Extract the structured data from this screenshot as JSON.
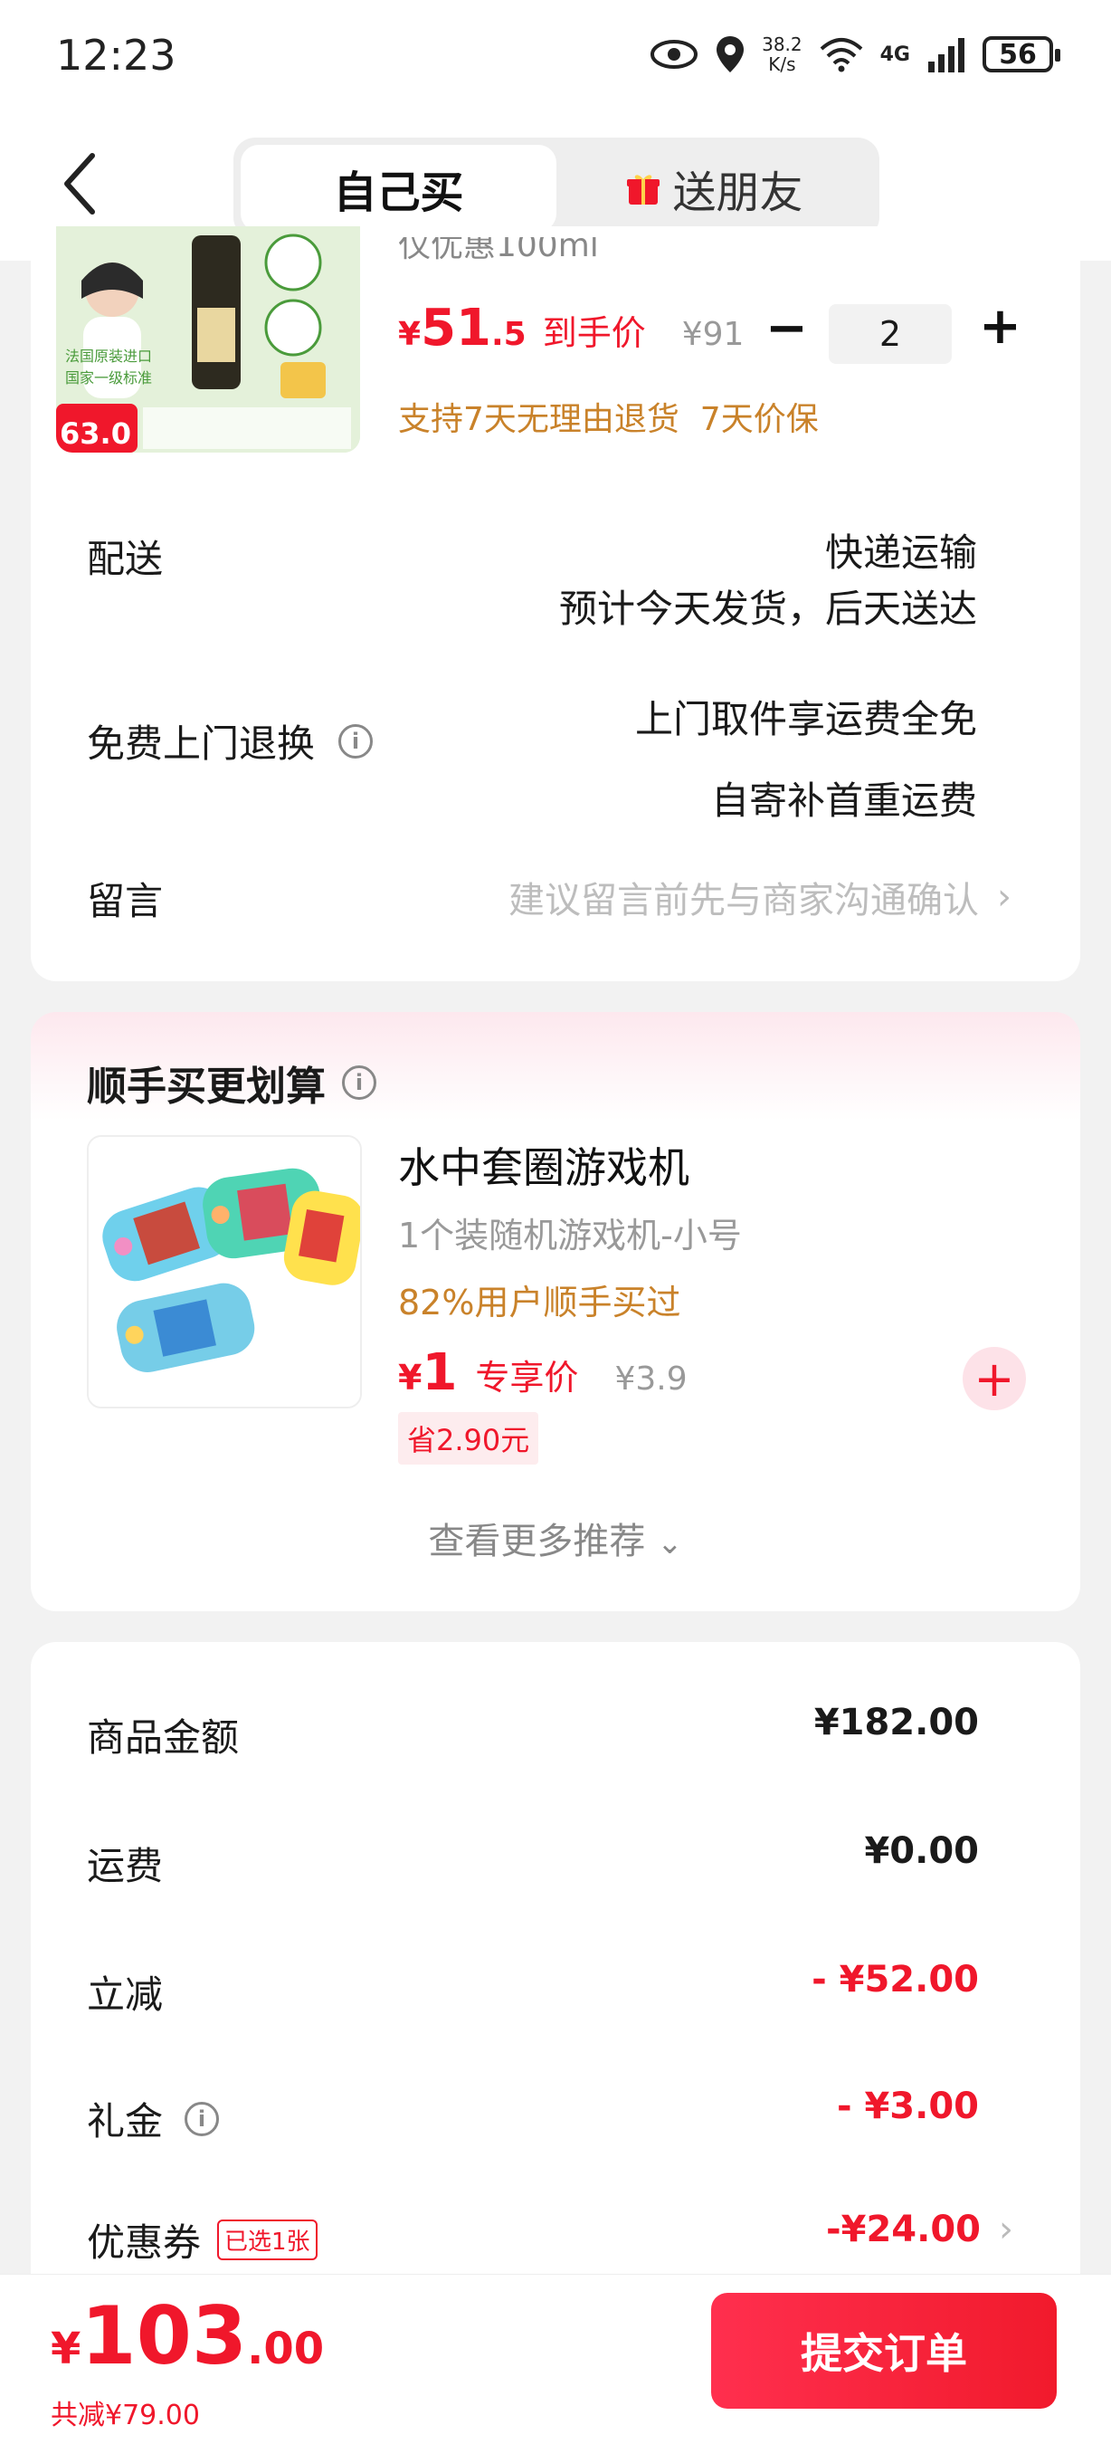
{
  "status_bar": {
    "time": "12:23",
    "speed_value": "38.2",
    "speed_unit": "K/s",
    "network": "4G",
    "battery": "56"
  },
  "header": {
    "tab_self": "自己买",
    "tab_gift": "送朋友"
  },
  "product": {
    "partial_subtitle": "仅优惠100ml",
    "price_symbol": "¥",
    "price_int": "51",
    "price_dec": ".5",
    "price_tag": "到手价",
    "original_price": "¥91",
    "quantity": "2",
    "guarantee": "支持7天无理由退货  7天价保",
    "thumb_badge": "63.0",
    "thumb_label1": "法国原装进口",
    "thumb_label2": "国家一级标准"
  },
  "delivery": {
    "label": "配送",
    "method": "快递运输",
    "eta": "预计今天发货，后天送达"
  },
  "returns": {
    "label": "免费上门退换",
    "line1": "上门取件享运费全免",
    "line2": "自寄补首重运费"
  },
  "message": {
    "label": "留言",
    "placeholder": "建议留言前先与商家沟通确认"
  },
  "addon": {
    "title": "顺手买更划算",
    "item_name": "水中套圈游戏机",
    "item_spec": "1个装随机游戏机-小号",
    "item_stat": "82%用户顺手买过",
    "price_symbol": "¥",
    "price": "1",
    "price_tag": "专享价",
    "original_price": "¥3.9",
    "save": "省2.90元",
    "more": "查看更多推荐"
  },
  "summary": {
    "goods_label": "商品金额",
    "goods_value": "¥182.00",
    "shipping_label": "运费",
    "shipping_value": "¥0.00",
    "discount_label": "立减",
    "discount_value": "- ¥52.00",
    "gift_label": "礼金",
    "gift_value": "- ¥3.00",
    "coupon_label": "优惠券",
    "coupon_tag": "已选1张",
    "coupon_value": "-¥24.00"
  },
  "bottom": {
    "total_symbol": "¥",
    "total_int": "103",
    "total_dec": ".00",
    "total_saved": "共减¥79.00",
    "submit": "提交订单"
  },
  "colors": {
    "accent": "#f0172b",
    "orange": "#c9822a",
    "gray": "#999999"
  }
}
